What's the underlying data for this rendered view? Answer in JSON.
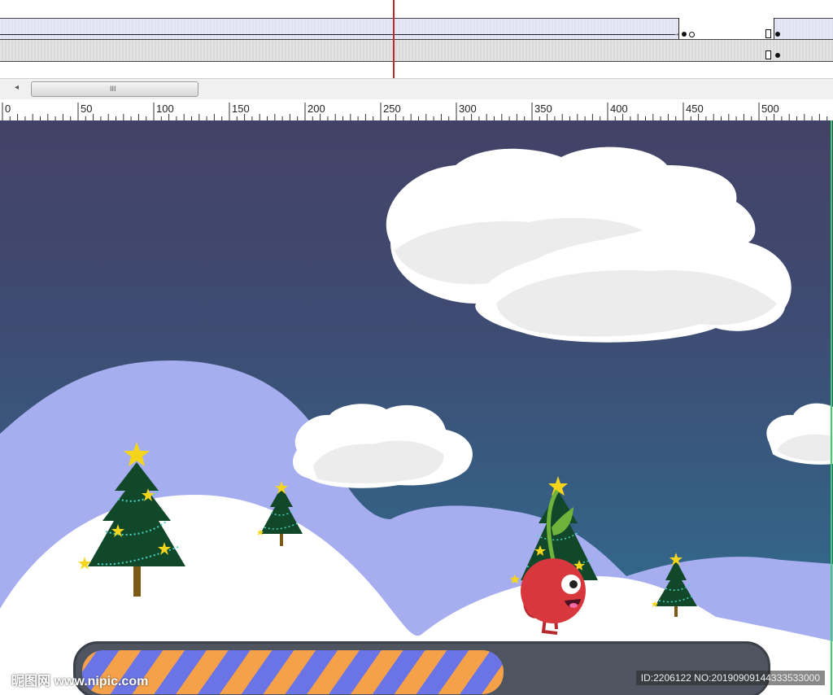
{
  "timeline": {
    "track_count": 2,
    "playhead_frame": 250
  },
  "scrollbar": {
    "left_arrow": "◂",
    "thumb_grip": "III"
  },
  "ruler": {
    "labels": [
      "0",
      "50",
      "100",
      "150",
      "200",
      "250",
      "300",
      "350",
      "400",
      "450",
      "500"
    ]
  },
  "stage": {
    "colors": {
      "sky_top": "#434266",
      "sky_bottom": "#2f6f92",
      "hills": "#a7aef0",
      "snow": "#ffffff",
      "cloud": "#ffffff",
      "tree": "#12482a",
      "star": "#f5d51c",
      "character": "#d8383d"
    },
    "progress": {
      "value_fraction": 0.62,
      "stripe_colors": [
        "#f4a14a",
        "#6b74e6"
      ]
    }
  },
  "watermark": {
    "site": "昵图网 www.nipic.com",
    "id_text": "ID:2206122 NO:20190909144333533000"
  }
}
